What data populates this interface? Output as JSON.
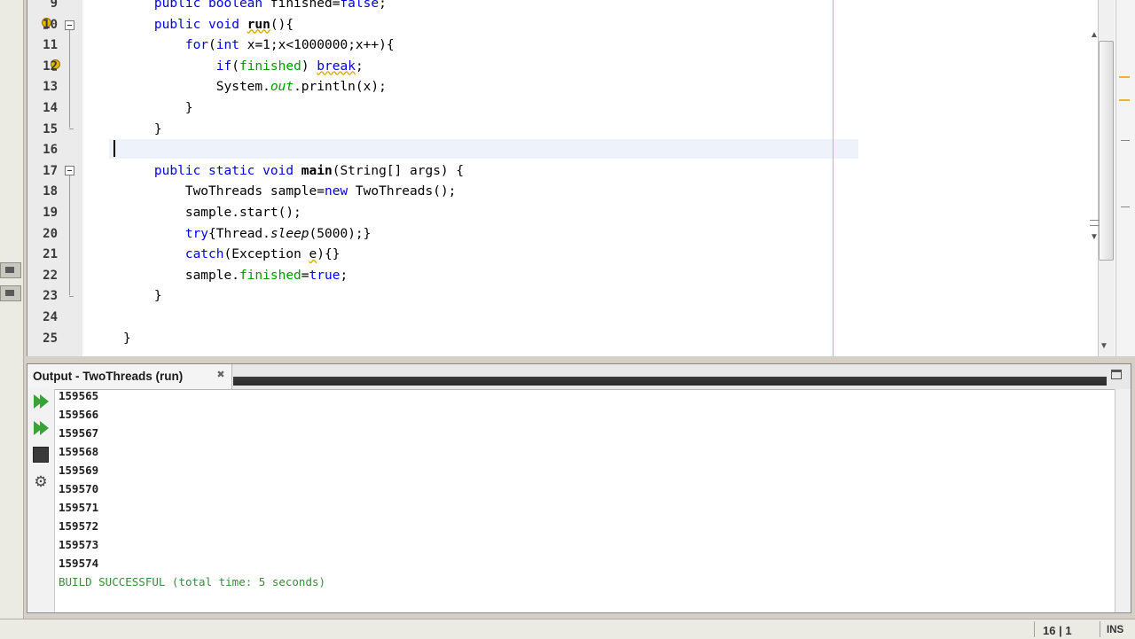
{
  "editor": {
    "lines": [
      {
        "num": "9",
        "code": [
          {
            "t": "    "
          },
          {
            "t": "public boolean",
            "c": "kw"
          },
          {
            "t": " finished="
          },
          {
            "t": "false",
            "c": "kw"
          },
          {
            "t": ";"
          }
        ]
      },
      {
        "num": "10",
        "code": [
          {
            "t": "    "
          },
          {
            "t": "public void",
            "c": "kw"
          },
          {
            "t": " "
          },
          {
            "t": "run",
            "c": "bold squig"
          },
          {
            "t": "(){"
          }
        ]
      },
      {
        "num": "11",
        "code": [
          {
            "t": "        "
          },
          {
            "t": "for",
            "c": "kw"
          },
          {
            "t": "("
          },
          {
            "t": "int",
            "c": "kw"
          },
          {
            "t": " x=1;x<1000000;x++){"
          }
        ]
      },
      {
        "num": "12",
        "code": [
          {
            "t": "            "
          },
          {
            "t": "if",
            "c": "kw"
          },
          {
            "t": "("
          },
          {
            "t": "finished",
            "c": "fld"
          },
          {
            "t": ") "
          },
          {
            "t": "break",
            "c": "kw squig"
          },
          {
            "t": ";"
          }
        ]
      },
      {
        "num": "13",
        "code": [
          {
            "t": "            System."
          },
          {
            "t": "out",
            "c": "fld it"
          },
          {
            "t": ".println(x);"
          }
        ]
      },
      {
        "num": "14",
        "code": [
          {
            "t": "        }"
          }
        ]
      },
      {
        "num": "15",
        "code": [
          {
            "t": "    }"
          }
        ]
      },
      {
        "num": "16",
        "code": [
          {
            "t": ""
          }
        ]
      },
      {
        "num": "17",
        "code": [
          {
            "t": "    "
          },
          {
            "t": "public static void",
            "c": "kw"
          },
          {
            "t": " "
          },
          {
            "t": "main",
            "c": "bold"
          },
          {
            "t": "(String[] args) {"
          }
        ]
      },
      {
        "num": "18",
        "code": [
          {
            "t": "        TwoThreads sample="
          },
          {
            "t": "new",
            "c": "kw"
          },
          {
            "t": " TwoThreads();"
          }
        ]
      },
      {
        "num": "19",
        "code": [
          {
            "t": "        sample.start();"
          }
        ]
      },
      {
        "num": "20",
        "code": [
          {
            "t": "        "
          },
          {
            "t": "try",
            "c": "kw"
          },
          {
            "t": "{Thread."
          },
          {
            "t": "sleep",
            "c": "it"
          },
          {
            "t": "(5000);}"
          }
        ]
      },
      {
        "num": "21",
        "code": [
          {
            "t": "        "
          },
          {
            "t": "catch",
            "c": "kw"
          },
          {
            "t": "(Exception "
          },
          {
            "t": "e",
            "c": "squig"
          },
          {
            "t": "){}"
          }
        ]
      },
      {
        "num": "22",
        "code": [
          {
            "t": "        sample."
          },
          {
            "t": "finished",
            "c": "fld"
          },
          {
            "t": "="
          },
          {
            "t": "true",
            "c": "kw"
          },
          {
            "t": ";"
          }
        ]
      },
      {
        "num": "23",
        "code": [
          {
            "t": "    }"
          }
        ]
      },
      {
        "num": "24",
        "code": [
          {
            "t": ""
          }
        ]
      },
      {
        "num": "25",
        "code": [
          {
            "t": "}"
          }
        ]
      }
    ]
  },
  "output": {
    "title": "Output - TwoThreads (run)",
    "close_symbol": "✖",
    "lines": [
      "159565",
      "159566",
      "159567",
      "159568",
      "159569",
      "159570",
      "159571",
      "159572",
      "159573",
      "159574"
    ],
    "build_message": "BUILD SUCCESSFUL (total time: 5 seconds)"
  },
  "statusbar": {
    "position": "16 | 1",
    "mode": "INS"
  },
  "colors": {
    "keyword": "#0000e6",
    "field": "#009900",
    "build_success": "#3c8a3c"
  },
  "icons": {
    "rerun": "rerun-icon",
    "rerun_with_params": "rerun-with-params-icon",
    "stop": "stop-icon",
    "settings": "settings-icon"
  }
}
